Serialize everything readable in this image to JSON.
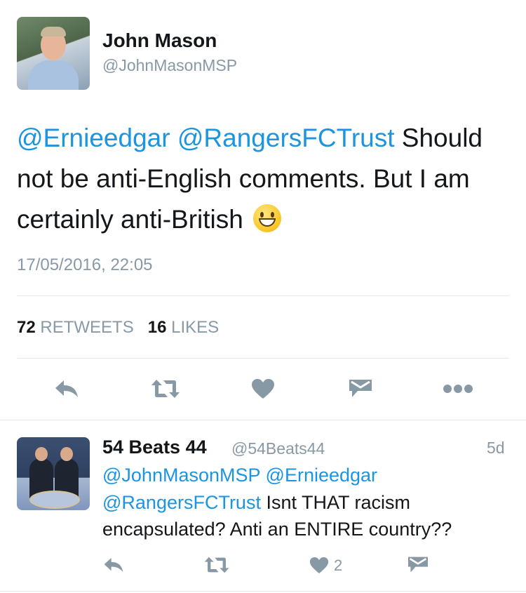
{
  "tweet": {
    "author_name": "John Mason",
    "author_handle": "@JohnMasonMSP",
    "mention1": "@Ernieedgar",
    "mention2": "@RangersFCTrust",
    "text_part1": " Should not be anti-English comments. But I am certainly anti-British ",
    "emoji": "grinning-face-emoji",
    "timestamp": "17/05/2016, 22:05",
    "retweet_count": "72",
    "retweet_label": "RETWEETS",
    "like_count": "16",
    "like_label": "LIKES"
  },
  "actions": [
    "reply-icon",
    "retweet-icon",
    "like-icon",
    "direct-message-icon",
    "more-icon"
  ],
  "reply": {
    "author_name": "54 Beats 44",
    "author_handle": "@54Beats44",
    "time": "5d",
    "mention1": "@JohnMasonMSP",
    "mention2": "@Ernieedgar",
    "mention3": "@RangersFCTrust",
    "text": " Isnt THAT racism encapsulated? Anti an ENTIRE country??",
    "like_count": "2"
  },
  "colors": {
    "mention": "#1b95e0",
    "text": "#14171a",
    "secondary": "#8899a6",
    "icon": "#8899a6",
    "divider": "#e1e8ed"
  }
}
